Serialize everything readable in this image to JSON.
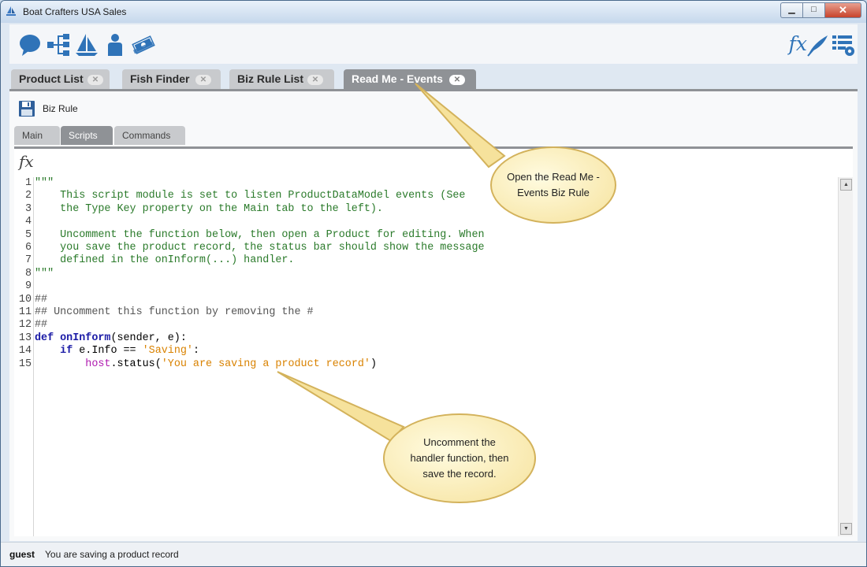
{
  "window": {
    "title": "Boat Crafters USA Sales",
    "minimize": "▁",
    "maximize": "□",
    "close": "✕"
  },
  "toolbar": {
    "left_icons": [
      "chat-bubble-icon",
      "network-tree-icon",
      "sailboat-icon",
      "person-icon",
      "money-icon"
    ],
    "right_icons": [
      "fx-function-icon",
      "quill-pen-icon",
      "settings-list-icon"
    ],
    "fx_label": "fx"
  },
  "doc_tabs": [
    {
      "label": "Product List",
      "active": false
    },
    {
      "label": "Fish Finder",
      "active": false
    },
    {
      "label": "Biz Rule List",
      "active": false
    },
    {
      "label": "Read Me - Events",
      "active": true
    }
  ],
  "close_glyph": "✕",
  "content": {
    "header_label": "Biz Rule",
    "sub_tabs": [
      {
        "label": "Main",
        "active": false
      },
      {
        "label": "Scripts",
        "active": true
      },
      {
        "label": "Commands",
        "active": false
      }
    ],
    "fx_label": "fx"
  },
  "editor": {
    "line_numbers": [
      "1",
      "2",
      "3",
      "4",
      "5",
      "6",
      "7",
      "8",
      "9",
      "10",
      "11",
      "12",
      "13",
      "14",
      "15"
    ],
    "lines": [
      "\"\"\"",
      "    This script module is set to listen ProductDataModel events (See",
      "    the Type Key property on the Main tab to the left).",
      "",
      "    Uncomment the function below, then open a Product for editing. When",
      "    you save the product record, the status bar should show the message",
      "    defined in the onInform(...) handler.",
      "\"\"\"",
      "",
      "##",
      "## Uncomment this function by removing the #",
      "##",
      {
        "kw": "def",
        "fn": " onInform",
        "rest": "(sender, e):"
      },
      {
        "indent": "    ",
        "kw": "if",
        "rest": " e.Info == ",
        "str": "'Saving'",
        "tail": ":"
      },
      {
        "indent": "        ",
        "mag": "host",
        "rest": ".status(",
        "str": "'You are saving a product record'",
        "tail": ")"
      }
    ]
  },
  "status": {
    "user": "guest",
    "message": "You are saving a product record"
  },
  "callouts": [
    {
      "text": "Open the Read Me - Events Biz Rule"
    },
    {
      "text": "Uncomment the handler function, then save the record."
    }
  ],
  "colors": {
    "comment": "#2a7a2a",
    "keyword": "#1a1aa6",
    "string": "#d98200",
    "builtin": "#b01ab0",
    "callout_fill": "#f6e29c"
  }
}
